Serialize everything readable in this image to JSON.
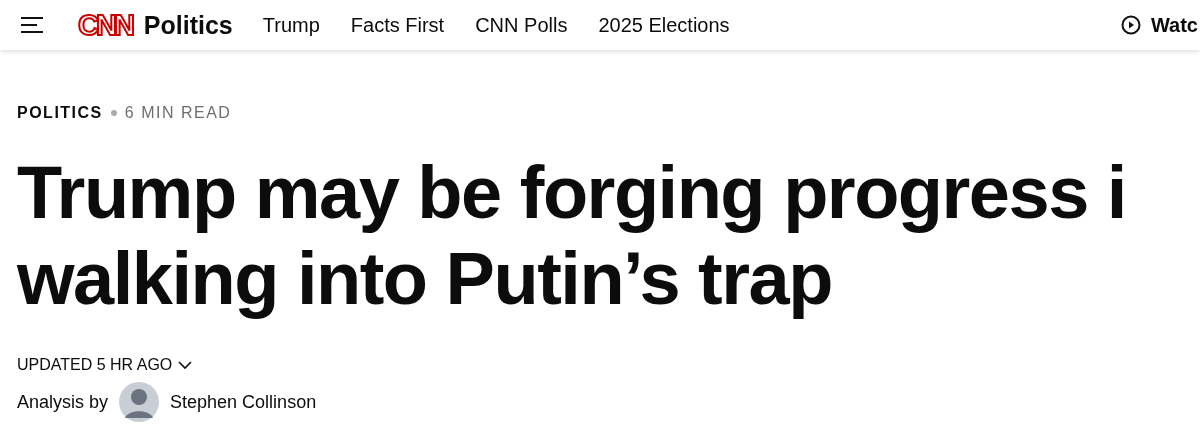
{
  "header": {
    "logo": "CNN",
    "section": "Politics",
    "nav": [
      "Trump",
      "Facts First",
      "CNN Polls",
      "2025 Elections"
    ],
    "watch": "Watc"
  },
  "article": {
    "section": "POLITICS",
    "read_time": "6 MIN READ",
    "headline_lines": [
      "Trump may be forging progress i",
      "walking into Putin’s trap"
    ],
    "updated": "UPDATED 5 HR AGO",
    "byline_prefix": "Analysis by",
    "author": "Stephen Collinson"
  }
}
